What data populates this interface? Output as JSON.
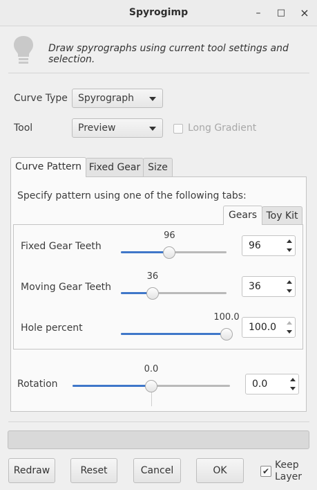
{
  "window": {
    "title": "Spyrogimp",
    "minimize_glyph": "–",
    "maximize_glyph": "□",
    "close_glyph": "×"
  },
  "header": {
    "icon": "lightbulb-icon",
    "description": "Draw spyrographs using current tool settings and selection."
  },
  "form": {
    "curve_type_label": "Curve Type",
    "curve_type_value": "Spyrograph",
    "tool_label": "Tool",
    "tool_value": "Preview",
    "long_gradient_label": "Long Gradient",
    "long_gradient_checked": false
  },
  "tabs": [
    {
      "label": "Curve Pattern"
    },
    {
      "label": "Fixed Gear"
    },
    {
      "label": "Size"
    }
  ],
  "curve_pattern": {
    "instruction": "Specify pattern using one of the following tabs:",
    "subtabs": [
      {
        "label": "Gears"
      },
      {
        "label": "Toy Kit"
      }
    ],
    "sliders": [
      {
        "label": "Fixed Gear Teeth",
        "display": "96",
        "spin": "96",
        "fraction": 0.46
      },
      {
        "label": "Moving Gear Teeth",
        "display": "36",
        "spin": "36",
        "fraction": 0.3
      },
      {
        "label": "Hole percent",
        "display": "100.0",
        "spin": "100.0",
        "fraction": 1.0
      }
    ],
    "rotation": {
      "label": "Rotation",
      "display": "0.0",
      "spin": "0.0",
      "fraction": 0.5
    }
  },
  "progress": {
    "fraction": 0
  },
  "buttons": {
    "redraw": "Redraw",
    "reset": "Reset",
    "cancel": "Cancel",
    "ok": "OK"
  },
  "keep_layer": {
    "label_line1": "Keep",
    "label_line2": "Layer",
    "checked": true,
    "check_glyph": "✔"
  },
  "colors": {
    "accent": "#3f77c9"
  }
}
